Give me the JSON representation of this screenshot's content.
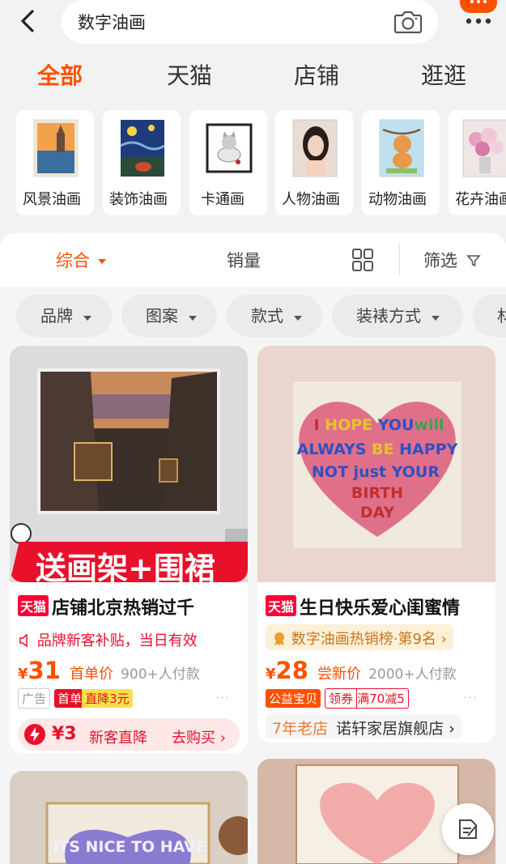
{
  "header": {
    "search_text": "数字油画",
    "back_icon": "back-arrow-icon",
    "camera_icon": "camera-icon",
    "more_icon": "more-dots-icon"
  },
  "tabs": [
    {
      "label": "全部"
    },
    {
      "label": "天猫"
    },
    {
      "label": "店铺"
    },
    {
      "label": "逛逛"
    }
  ],
  "categories": [
    {
      "label": "风景油画"
    },
    {
      "label": "装饰油画"
    },
    {
      "label": "卡通画"
    },
    {
      "label": "人物油画"
    },
    {
      "label": "动物油画"
    },
    {
      "label": "花卉油画"
    }
  ],
  "sort": {
    "zonghe": "综合",
    "sales": "销量",
    "filter": "筛选"
  },
  "chips": [
    {
      "label": "品牌"
    },
    {
      "label": "图案"
    },
    {
      "label": "款式"
    },
    {
      "label": "装裱方式"
    },
    {
      "label": "材"
    }
  ],
  "products": [
    {
      "badge": "天猫",
      "title": "店铺北京热销过千",
      "banner": "送画架+围裙",
      "subsidy": "品牌新客补贴，当日有效",
      "price_symbol": "¥",
      "price": "31",
      "price_label": "首单价",
      "sold": "900+人付款",
      "ad": "广告",
      "first": "首单",
      "drop": "直降3元",
      "more": "···",
      "promo_amount": "¥3",
      "promo_text": "新客直降",
      "promo_action": "去购买"
    },
    {
      "badge": "天猫",
      "title": "生日快乐爱心闺蜜情",
      "rank": "数字油画热销榜·第9名",
      "price_symbol": "¥",
      "price": "28",
      "price_label": "尝新价",
      "sold": "2000+人付款",
      "tag1": "公益宝贝",
      "tag2a": "领券",
      "tag2b": "满70减5",
      "more": "···",
      "store_age": "7年老店",
      "store_name": "诺轩家居旗舰店",
      "heart_lines": [
        "I HOPE YOU will",
        "ALWAYS BE HAPPY",
        "NOT just YOUR",
        "BIRTH",
        "DAY"
      ]
    }
  ],
  "bottom_left_heart_text": "ITS NICE TO HAVE",
  "colors": {
    "accent": "#ff5000",
    "tmall": "#ff0036",
    "background": "#f2f2f2"
  },
  "floating": {
    "icon": "edit-note-icon"
  }
}
